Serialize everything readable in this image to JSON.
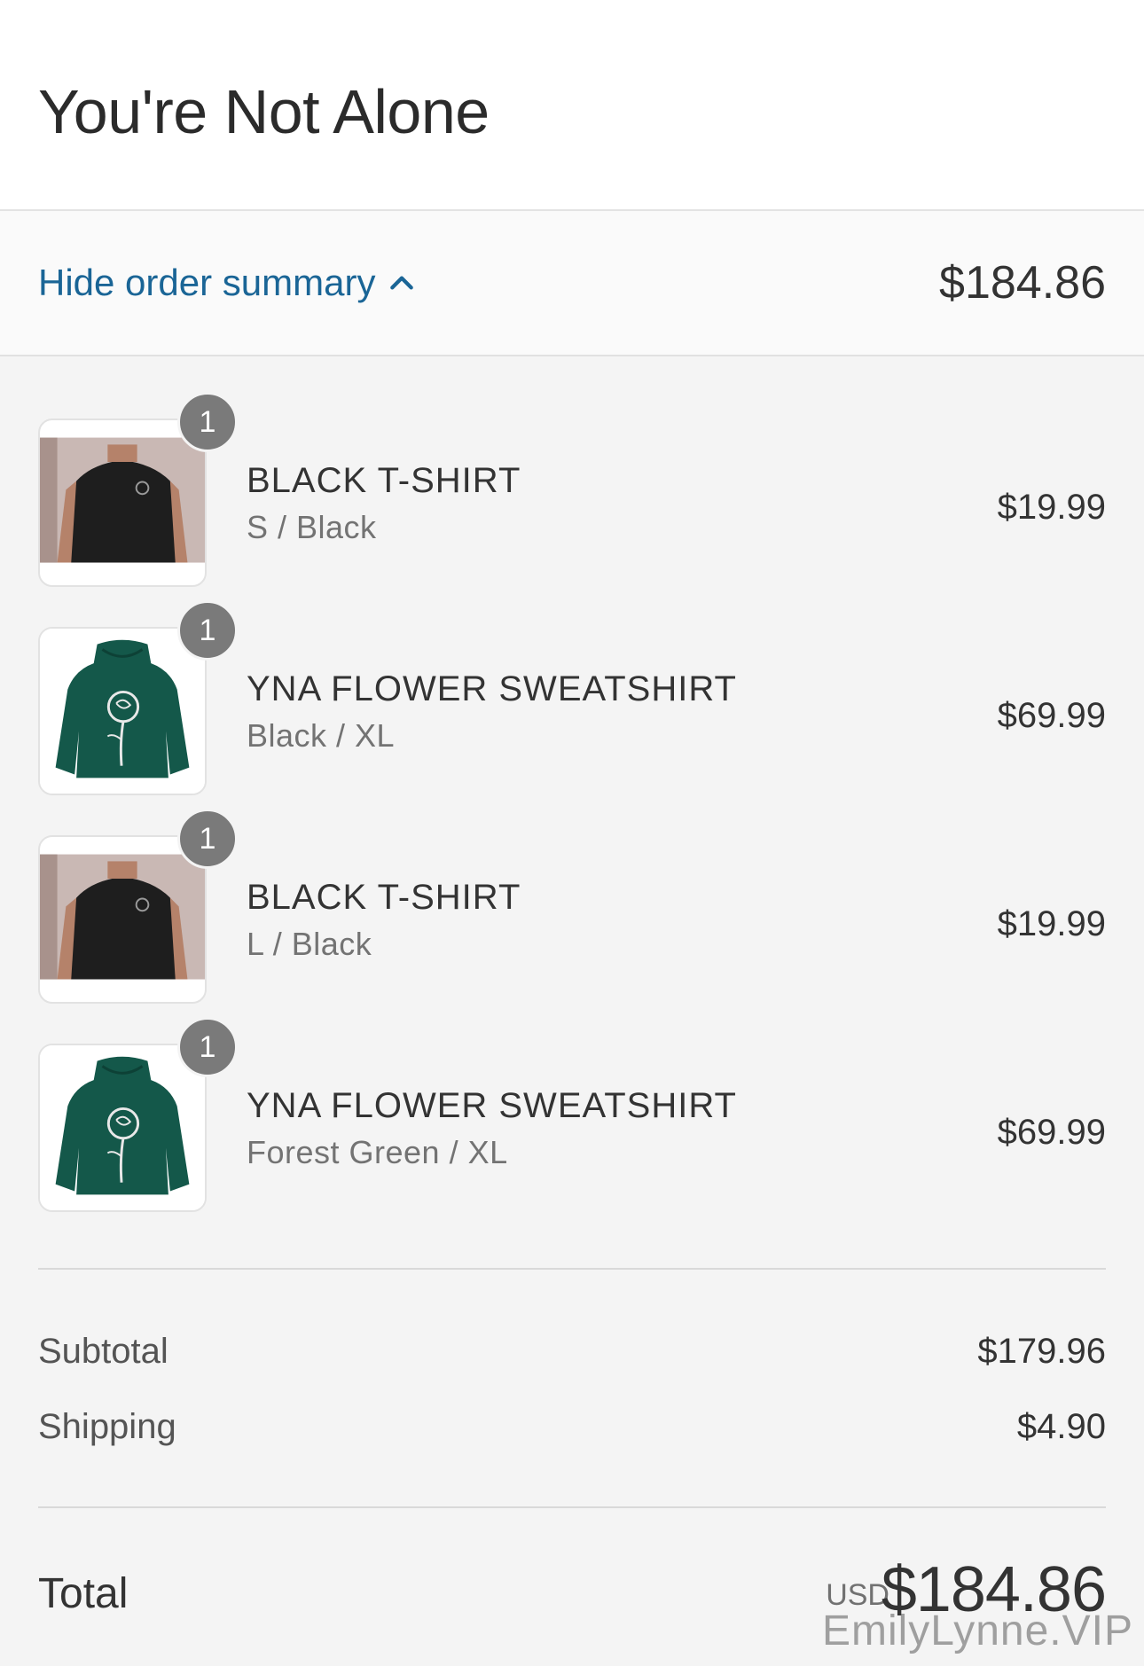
{
  "store": {
    "title": "You're Not Alone"
  },
  "summary_bar": {
    "toggle_label": "Hide order summary",
    "toggle_icon": "chevron-up-icon",
    "total": "$184.86"
  },
  "items": [
    {
      "name": "BLACK T-SHIRT",
      "variant": "S / Black",
      "price": "$19.99",
      "quantity": "1",
      "image": "black-tshirt-photo"
    },
    {
      "name": "YNA FLOWER SWEATSHIRT",
      "variant": "Black / XL",
      "price": "$69.99",
      "quantity": "1",
      "image": "green-hoodie-flower"
    },
    {
      "name": "BLACK T-SHIRT",
      "variant": "L / Black",
      "price": "$19.99",
      "quantity": "1",
      "image": "black-tshirt-photo"
    },
    {
      "name": "YNA FLOWER SWEATSHIRT",
      "variant": "Forest Green / XL",
      "price": "$69.99",
      "quantity": "1",
      "image": "green-hoodie-flower"
    }
  ],
  "totals": {
    "subtotal_label": "Subtotal",
    "subtotal_value": "$179.96",
    "shipping_label": "Shipping",
    "shipping_value": "$4.90",
    "total_label": "Total",
    "currency": "USD",
    "total_value": "$184.86"
  },
  "watermark": "EmilyLynne.VIP",
  "colors": {
    "link": "#1a6596",
    "badge": "#7a7a7a",
    "hoodie": "#14584a"
  }
}
